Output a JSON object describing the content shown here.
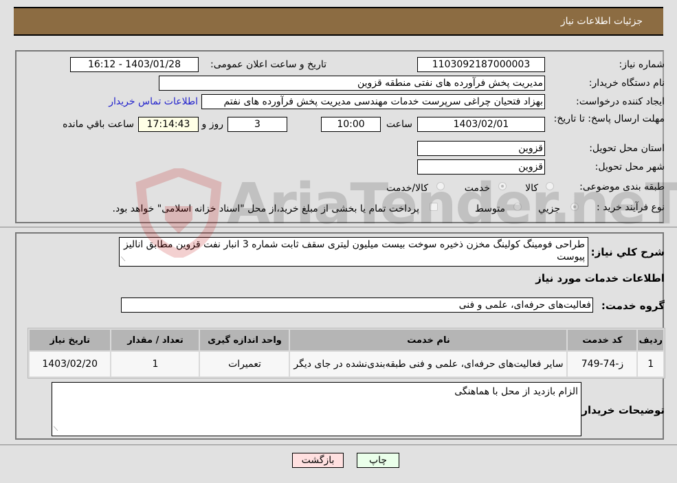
{
  "header": {
    "title": "جزئیات اطلاعات نیاز"
  },
  "form": {
    "need_number": {
      "label": "شماره نیاز:",
      "value": "1103092187000003"
    },
    "announce_datetime": {
      "label": "تاریخ و ساعت اعلان عمومی:",
      "value": "1403/01/28 - 16:12"
    },
    "buyer_org": {
      "label": "نام دستگاه خریدار:",
      "value": "مدیریت پخش فرآورده های نفتی منطقه قزوین"
    },
    "requester": {
      "label": "ایجاد کننده درخواست:",
      "value": "بهزاد فتحیان چراغی سرپرست خدمات مهندسی مدیریت پخش فرآورده های نفتم"
    },
    "buyer_contact_link": "اطلاعات تماس خریدار",
    "deadline": {
      "label": "مهلت ارسال پاسخ: تا تاریخ:",
      "date": "1403/02/01",
      "time_label": "ساعت",
      "time": "10:00",
      "days": "3",
      "days_label": "روز و",
      "remaining": "17:14:43",
      "remaining_label": "ساعت باقي مانده"
    },
    "province": {
      "label": "استان محل تحویل:",
      "value": "قزوین"
    },
    "city": {
      "label": "شهر محل تحویل:",
      "value": "قزوین"
    },
    "category": {
      "label": "طبقه بندی موضوعی:",
      "options": [
        "کالا",
        "خدمت",
        "کالا/خدمت"
      ],
      "selected": "خدمت"
    },
    "purchase_type": {
      "label": "نوع فرآیند خرید :",
      "options": [
        "جزيي",
        "متوسط"
      ],
      "selected": "جزيي",
      "treasury_note": "پرداخت تمام یا بخشی از مبلغ خرید،از محل \"اسناد خزانه اسلامی\" خواهد بود."
    }
  },
  "description": {
    "label": "شرح کلي نياز:",
    "value": "طراحی فومینگ کولینگ مخزن ذخیره سوخت بیست میلیون لیتری سقف ثابت شماره 3 انبار نفت قزوین مطابق انالیز پیوست"
  },
  "services": {
    "section_title": "اطلاعات خدمات مورد نیاز",
    "group_label": "گروه خدمت:",
    "group_value": "فعالیت‌های حرفه‌ای، علمی و فنی",
    "table": {
      "headers": [
        "ردیف",
        "کد خدمت",
        "نام خدمت",
        "واحد اندازه گیری",
        "تعداد / مقدار",
        "تاریخ نیاز"
      ],
      "rows": [
        [
          "1",
          "ز-74-749",
          "سایر فعالیت‌های حرفه‌ای، علمی و فنی طبقه‌بندی‌نشده در جای دیگر",
          "تعمیرات",
          "1",
          "1403/02/20"
        ]
      ]
    }
  },
  "buyer_notes": {
    "label": "توضیحات خریدار:",
    "value": "الزام بازدید از محل با هماهنگی"
  },
  "buttons": {
    "print": "چاپ",
    "back": "بازگشت"
  },
  "watermark": "AriaTender.neT"
}
